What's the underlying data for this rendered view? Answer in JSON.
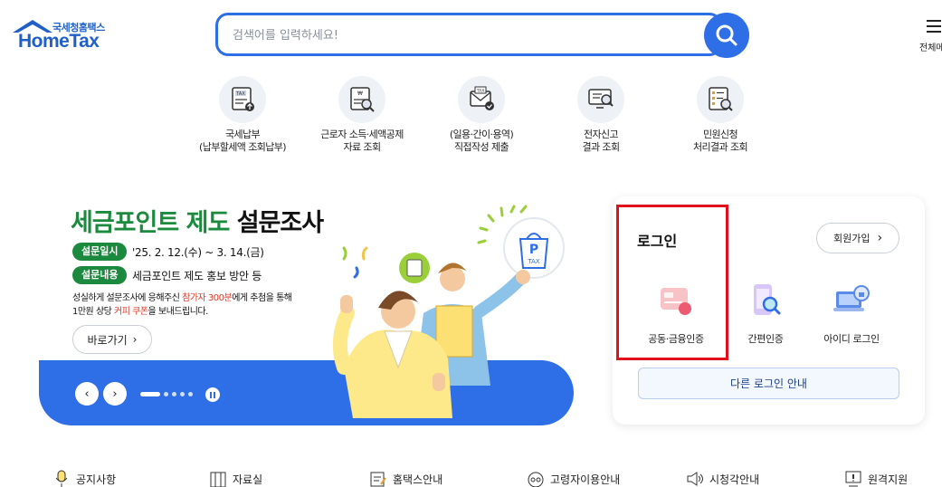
{
  "header": {
    "logo_sub": "국세청홈택스",
    "logo_main": "HomeTax",
    "search_placeholder": "검색어를 입력하세요!",
    "menu_label": "전체메"
  },
  "quick_menu": [
    {
      "line1": "국세납부",
      "line2": "(납부할세액 조회납부)"
    },
    {
      "line1": "근로자 소득·세액공제",
      "line2": "자료 조회"
    },
    {
      "line1": "(일용·간이·용역)",
      "line2": "직접작성 제출"
    },
    {
      "line1": "전자신고",
      "line2": "결과 조회"
    },
    {
      "line1": "민원신청",
      "line2": "처리결과 조회"
    }
  ],
  "banner": {
    "title_green": "세금포인트 제도",
    "title_black": "설문조사",
    "date_label": "설문일시",
    "date_value": "'25. 2. 12.(수) ~ 3. 14.(금)",
    "content_label": "설문내용",
    "content_value": "세금포인트 제도 홍보 방안 등",
    "desc1_a": "성실하게 설문조사에 응해주신 ",
    "desc1_red": "참가자 300분",
    "desc1_b": "에게 추첨을 통해",
    "desc2_a": "1만원 상당 ",
    "desc2_red": "커피 쿠폰",
    "desc2_b": "을 보내드립니다.",
    "go_label": "바로가기",
    "tax_tag": "TAX",
    "p_tag": "P"
  },
  "login": {
    "title": "로그인",
    "signup": "회원가입",
    "options": [
      {
        "label": "공동·금융인증",
        "icon": "certificate-card-icon"
      },
      {
        "label": "간편인증",
        "icon": "phone-search-icon"
      },
      {
        "label": "아이디 로그인",
        "icon": "laptop-lock-icon"
      }
    ],
    "other": "다른 로그인 안내"
  },
  "footer": [
    {
      "label": "공지사항",
      "icon": "microphone-icon"
    },
    {
      "label": "자료실",
      "icon": "archive-icon"
    },
    {
      "label": "홈택스안내",
      "icon": "guide-icon"
    },
    {
      "label": "고령자이용안내",
      "icon": "elderly-icon"
    },
    {
      "label": "시청각안내",
      "icon": "speaker-icon"
    },
    {
      "label": "원격지원",
      "icon": "remote-support-icon"
    }
  ],
  "colors": {
    "primary": "#2e6ee6",
    "green": "#1c8a3e",
    "highlight": "#e0101c"
  }
}
